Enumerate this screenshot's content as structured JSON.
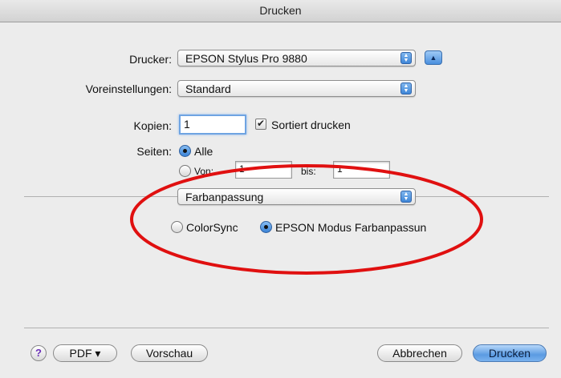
{
  "window": {
    "title": "Drucken"
  },
  "printer": {
    "label": "Drucker:",
    "value": "EPSON Stylus Pro 9880"
  },
  "presets": {
    "label": "Voreinstellungen:",
    "value": "Standard"
  },
  "copies": {
    "label": "Kopien:",
    "value": "1",
    "collate_label": "Sortiert drucken",
    "collate_checked": true
  },
  "pages": {
    "label": "Seiten:",
    "all_label": "Alle",
    "from_label": "Von:",
    "from_value": "1",
    "to_label": "bis:",
    "to_value": "1"
  },
  "panel": {
    "value": "Farbanpassung"
  },
  "color_matching": {
    "option1": "ColorSync",
    "option2": "EPSON Modus Farbanpassun",
    "selected": "option2"
  },
  "footer": {
    "help": "?",
    "pdf": "PDF ▾",
    "preview": "Vorschau",
    "cancel": "Abbrechen",
    "print": "Drucken"
  },
  "annotation": {
    "color": "#e01010"
  },
  "colors": {
    "accent": "#3f86d8",
    "background": "#ececec"
  }
}
